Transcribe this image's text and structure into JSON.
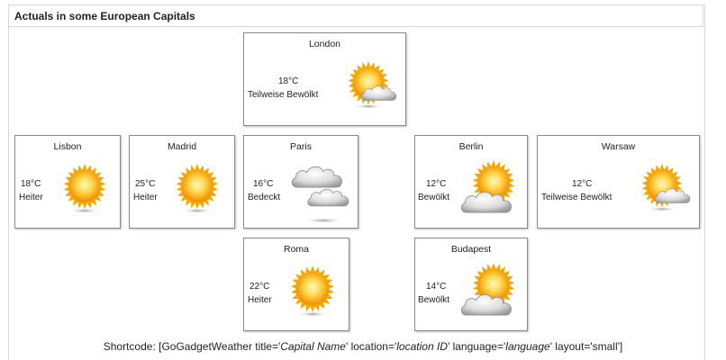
{
  "header": {
    "title": "Actuals in some European Capitals"
  },
  "cards": {
    "london": {
      "city": "London",
      "temp": "18°C",
      "condition": "Teilweise Bewölkt",
      "icon": "partly-cloudy-icon"
    },
    "lisbon": {
      "city": "Lisbon",
      "temp": "18°C",
      "condition": "Heiter",
      "icon": "sun-icon"
    },
    "madrid": {
      "city": "Madrid",
      "temp": "25°C",
      "condition": "Heiter",
      "icon": "sun-icon"
    },
    "paris": {
      "city": "Paris",
      "temp": "16°C",
      "condition": "Bedeckt",
      "icon": "overcast-icon"
    },
    "berlin": {
      "city": "Berlin",
      "temp": "12°C",
      "condition": "Bewölkt",
      "icon": "cloudy-icon"
    },
    "warsaw": {
      "city": "Warsaw",
      "temp": "12°C",
      "condition": "Teilweise Bewölkt",
      "icon": "partly-cloudy-icon"
    },
    "roma": {
      "city": "Roma",
      "temp": "22°C",
      "condition": "Heiter",
      "icon": "sun-icon"
    },
    "budapest": {
      "city": "Budapest",
      "temp": "14°C",
      "condition": "Bewölkt",
      "icon": "cloudy-icon"
    }
  },
  "shortcode": {
    "prefix": "Shortcode: [GoGadgetWeather title='",
    "title_value": "Capital Name",
    "part2": "' location='",
    "location_value": "location ID",
    "part3": "' language='",
    "language_value": "language",
    "suffix": "' layout='small']"
  },
  "colors": {
    "card_border": "#8a8a8a",
    "sun_core": "#ffe680",
    "sun_edge": "#f29a00",
    "cloud": "#d9d9d9"
  }
}
